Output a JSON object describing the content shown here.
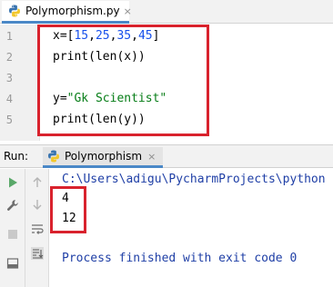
{
  "editor_tab": {
    "label": "Polymorphism.py",
    "close": "×"
  },
  "line_numbers": [
    "1",
    "2",
    "3",
    "4",
    "5"
  ],
  "code": {
    "line1": {
      "pre": "x=[",
      "n1": "15",
      "c1": ",",
      "n2": "25",
      "c2": ",",
      "n3": "35",
      "c3": ",",
      "n4": "45",
      "post": "]"
    },
    "line2": "print(len(x))",
    "line4": {
      "pre": "y=",
      "str": "\"Gk Scientist\""
    },
    "line5": "print(len(y))"
  },
  "run_panel": {
    "label": "Run:",
    "tab_label": "Polymorphism",
    "close": "×"
  },
  "console": {
    "command": "C:\\Users\\adigu\\PycharmProjects\\python",
    "output": [
      "4",
      "12"
    ],
    "exit_message": "Process finished with exit code 0"
  },
  "colors": {
    "highlight": "#d9222d",
    "number": "#1750eb",
    "string": "#067d17",
    "console_path": "#1f3fa6",
    "tab_accent": "#4a88c7"
  },
  "icons": [
    "python-file-icon",
    "play-icon",
    "wrench-icon",
    "stop-icon",
    "layout-icon",
    "up-arrow-icon",
    "down-arrow-icon",
    "soft-wrap-icon",
    "scroll-to-end-icon",
    "fold-icon"
  ]
}
